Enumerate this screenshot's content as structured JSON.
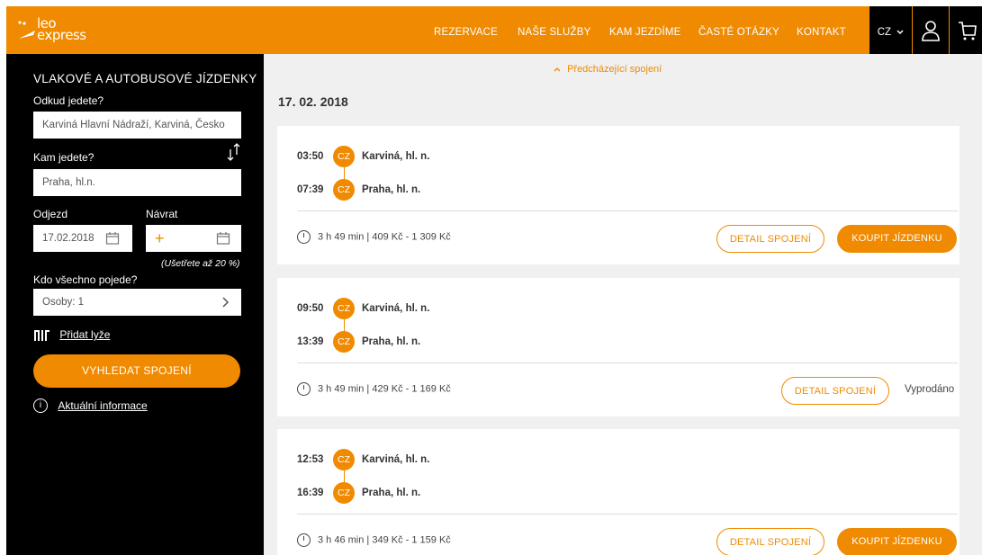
{
  "brand": {
    "logo_line1": "leo",
    "logo_line2": "express",
    "accent": "#f08a00"
  },
  "nav": [
    "REZERVACE",
    "NAŠE SLUŽBY",
    "KAM JEZDÍME",
    "ČASTÉ OTÁZKY",
    "KONTAKT"
  ],
  "lang": {
    "label": "CZ"
  },
  "sidebar": {
    "title": "VLAKOVÉ A AUTOBUSOVÉ JÍZDENKY",
    "from_label": "Odkud jedete?",
    "from_value": "Karviná Hlavní Nádraží, Karviná, Česko",
    "to_label": "Kam jedete?",
    "to_value": "Praha, hl.n.",
    "depart_label": "Odjezd",
    "depart_value": "17.02.2018",
    "return_label": "Návrat",
    "return_plus": "+",
    "saving": "(Ušetřete až 20 %)",
    "passengers_label": "Kdo všechno pojede?",
    "passengers_value": "Osoby: 1",
    "ski_label": "Přidat lyže",
    "search_button": "VYHLEDAT SPOJENÍ",
    "info_label": "Aktuální informace"
  },
  "main": {
    "prev_link": "Předcházející spojení",
    "date": "17. 02. 2018",
    "connections": [
      {
        "dep_time": "03:50",
        "dep_country": "CZ",
        "dep_station": "Karviná, hl. n.",
        "arr_time": "07:39",
        "arr_country": "CZ",
        "arr_station": "Praha, hl. n.",
        "meta": "3 h 49 min | 409 Kč - 1 309 Kč",
        "detail": "DETAIL SPOJENÍ",
        "buy": "KOUPIT JÍZDENKU",
        "sold_out": ""
      },
      {
        "dep_time": "09:50",
        "dep_country": "CZ",
        "dep_station": "Karviná, hl. n.",
        "arr_time": "13:39",
        "arr_country": "CZ",
        "arr_station": "Praha, hl. n.",
        "meta": "3 h 49 min | 429 Kč - 1 169 Kč",
        "detail": "DETAIL SPOJENÍ",
        "buy": "",
        "sold_out": "Vyprodáno"
      },
      {
        "dep_time": "12:53",
        "dep_country": "CZ",
        "dep_station": "Karviná, hl. n.",
        "arr_time": "16:39",
        "arr_country": "CZ",
        "arr_station": "Praha, hl. n.",
        "meta": "3 h 46 min | 349 Kč - 1 159 Kč",
        "detail": "DETAIL SPOJENÍ",
        "buy": "KOUPIT JÍZDENKU",
        "sold_out": ""
      }
    ]
  }
}
